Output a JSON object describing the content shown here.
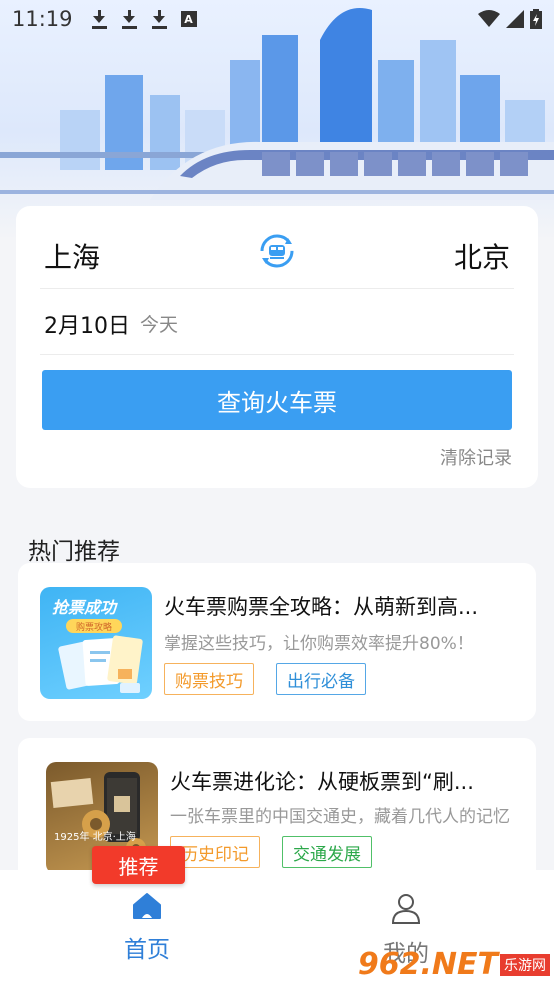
{
  "status_bar": {
    "time": "11:19",
    "icon_a": "A"
  },
  "search": {
    "from_city": "上海",
    "to_city": "北京",
    "date": "2月10日",
    "day_label": "今天",
    "query_button": "查询火车票",
    "clear_label": "清除记录"
  },
  "section": {
    "title": "热门推荐"
  },
  "articles": [
    {
      "title": "火车票购票全攻略：从萌新到高...",
      "subtitle": "掌握这些技巧，让你购票效率提升80%！",
      "tags": [
        "购票技巧",
        "出行必备"
      ],
      "thumb_text": "抢票成功",
      "thumb_subtext": "购票攻略"
    },
    {
      "title": "火车票进化论：从硬板票到“刷...",
      "subtitle": "一张车票里的中国交通史，藏着几代人的记忆",
      "tags": [
        "历史印记",
        "交通发展"
      ],
      "thumb_text": "1925年 北京·上海"
    }
  ],
  "badge": "推荐",
  "nav": {
    "home": "首页",
    "mine": "我的"
  },
  "watermark": {
    "main": "962.NET",
    "sub": "乐游网"
  },
  "colors": {
    "primary": "#3a9ef2",
    "badge": "#f23a2a",
    "nav_active": "#2f7fd8"
  }
}
